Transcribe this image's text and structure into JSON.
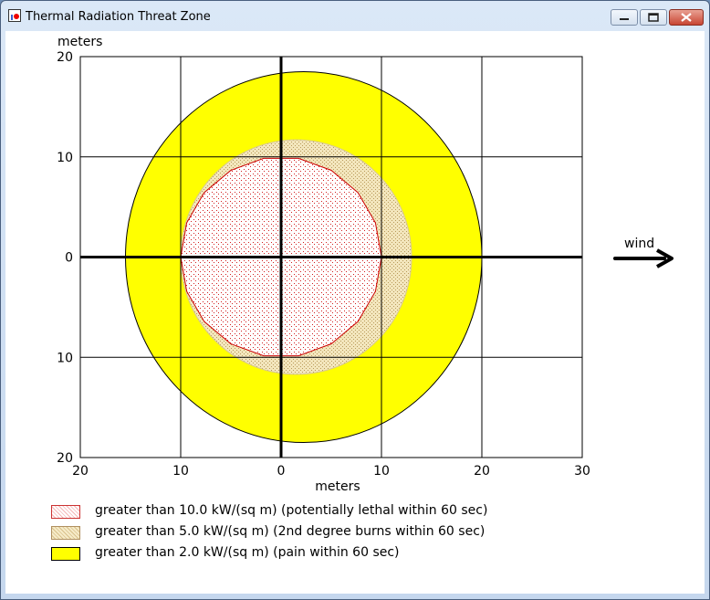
{
  "window": {
    "title": "Thermal Radiation Threat Zone"
  },
  "chart_data": {
    "type": "threat-zone",
    "xlabel": "meters",
    "ylabel": "meters",
    "xlim": [
      -20,
      30
    ],
    "ylim": [
      -20,
      20
    ],
    "x_ticks": [
      {
        "value": -20,
        "label": "20"
      },
      {
        "value": -10,
        "label": "10"
      },
      {
        "value": 0,
        "label": "0"
      },
      {
        "value": 10,
        "label": "10"
      },
      {
        "value": 20,
        "label": "20"
      },
      {
        "value": 30,
        "label": "30"
      }
    ],
    "y_ticks": [
      {
        "value": 20,
        "label": "20"
      },
      {
        "value": 10,
        "label": "10"
      },
      {
        "value": 0,
        "label": "0"
      },
      {
        "value": -10,
        "label": "10"
      },
      {
        "value": -20,
        "label": "20"
      }
    ],
    "grid": true,
    "wind_label": "wind",
    "zones": [
      {
        "label": "greater than 2.0 kW/(sq m) (pain within 60 sec)",
        "color": "#ffff00",
        "pattern": "solid",
        "x_min": -15.5,
        "x_max": 20,
        "y_min": -18.5,
        "y_max": 18.5
      },
      {
        "label": "greater than 5.0 kW/(sq m) (2nd degree burns within 60 sec)",
        "color": "#f0e0b0",
        "pattern": "dots",
        "x_min": -10,
        "x_max": 13,
        "y_min": -11.7,
        "y_max": 11.7
      },
      {
        "label": "greater than 10.0 kW/(sq m) (potentially lethal within 60 sec)",
        "color": "#f4c4c4",
        "pattern": "red-dots",
        "x_min": -10,
        "x_max": 10,
        "y_min": -10,
        "y_max": 10
      }
    ]
  },
  "legend": [
    {
      "label": "greater than 10.0 kW/(sq m) (potentially lethal within 60 sec)",
      "color": "#ff8080",
      "pattern": "red-dots"
    },
    {
      "label": "greater than 5.0 kW/(sq m) (2nd degree burns within 60 sec)",
      "color": "#f0e0b0",
      "pattern": "dots"
    },
    {
      "label": "greater than 2.0 kW/(sq m) (pain within 60 sec)",
      "color": "#ffff00",
      "pattern": "solid"
    }
  ]
}
